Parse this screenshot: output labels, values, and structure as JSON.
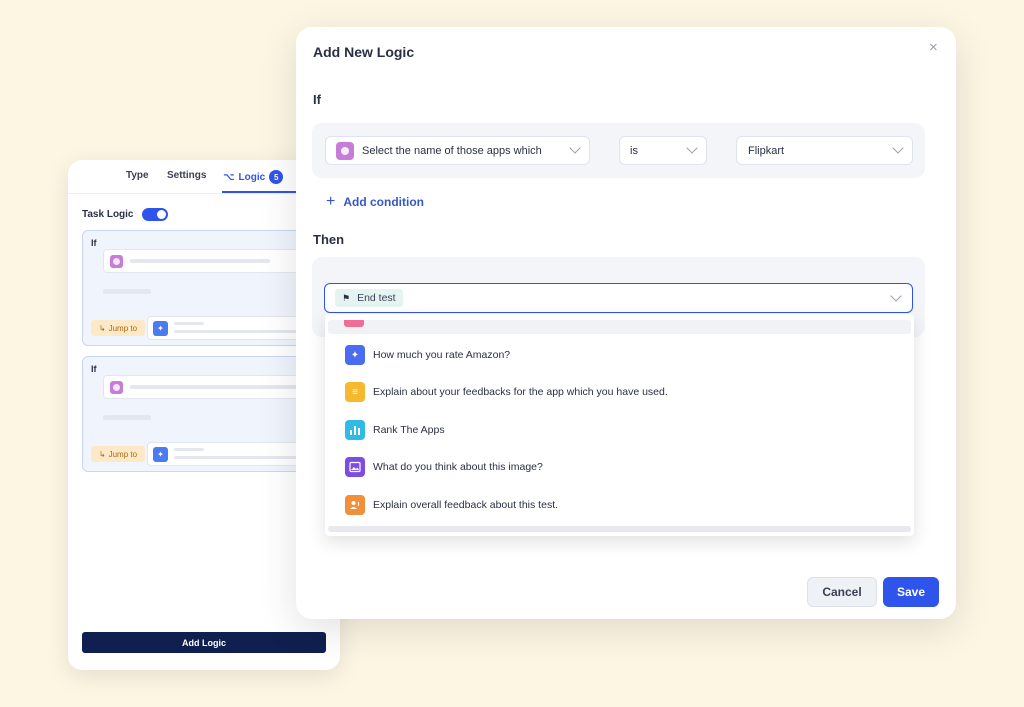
{
  "panel": {
    "tabs": {
      "type": "Type",
      "settings": "Settings",
      "logic": "Logic",
      "logic_count": "5"
    },
    "task_logic_label": "Task Logic",
    "if_label": "If",
    "jump_to": "Jump to",
    "add_logic": "Add Logic"
  },
  "modal": {
    "title": "Add New Logic",
    "close": "×",
    "if_label": "If",
    "condition": {
      "question": "Select the name of those apps which",
      "operator": "is",
      "value": "Flipkart"
    },
    "add_condition": "Add condition",
    "then_label": "Then",
    "then_tag": "End test",
    "options": [
      {
        "label": "How much you rate Amazon?",
        "icon": "rating-icon",
        "color": "#4a6cf0"
      },
      {
        "label": "Explain about your feedbacks for the app which you have used.",
        "icon": "text-lines-icon",
        "color": "#f5b82e"
      },
      {
        "label": "Rank The Apps",
        "icon": "bar-chart-icon",
        "color": "#2fbbe6"
      },
      {
        "label": "What do you think about this image?",
        "icon": "image-icon",
        "color": "#7c4de0"
      },
      {
        "label": "Explain overall feedback about this test.",
        "icon": "voice-feedback-icon",
        "color": "#f0903a"
      }
    ],
    "cancel": "Cancel",
    "save": "Save"
  },
  "colors": {
    "accent": "#2f54eb",
    "navy": "#0f1f4f",
    "background": "#fdf6e3"
  }
}
